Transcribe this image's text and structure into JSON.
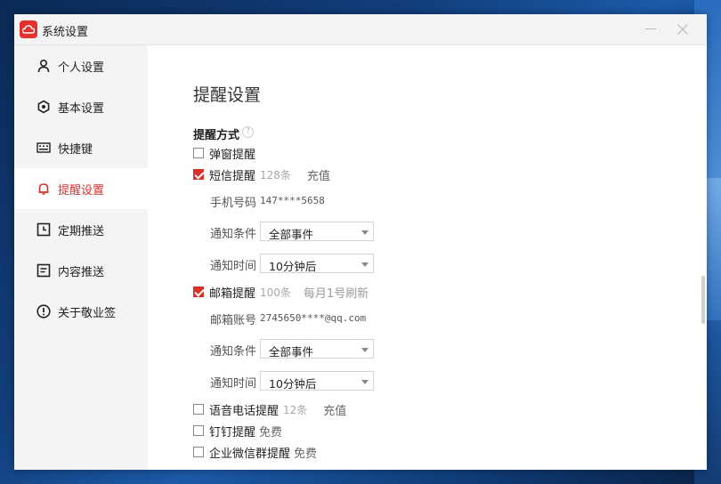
{
  "window": {
    "title": "系统设置"
  },
  "sidebar": {
    "items": [
      {
        "label": "个人设置",
        "icon": "user-icon",
        "active": false
      },
      {
        "label": "基本设置",
        "icon": "settings-icon",
        "active": false
      },
      {
        "label": "快捷键",
        "icon": "keyboard-icon",
        "active": false
      },
      {
        "label": "提醒设置",
        "icon": "bell-icon",
        "active": true
      },
      {
        "label": "定期推送",
        "icon": "schedule-icon",
        "active": false
      },
      {
        "label": "内容推送",
        "icon": "document-icon",
        "active": false
      },
      {
        "label": "关于敬业签",
        "icon": "info-icon",
        "active": false
      }
    ]
  },
  "main": {
    "title": "提醒设置",
    "section_title": "提醒方式",
    "popup": {
      "label": "弹窗提醒",
      "checked": false
    },
    "sms": {
      "label": "短信提醒",
      "checked": true,
      "count": "128条",
      "action": "充值",
      "phone_label": "手机号码",
      "phone_value": "147****5658",
      "condition_label": "通知条件",
      "condition_value": "全部事件",
      "time_label": "通知时间",
      "time_value": "10分钟后"
    },
    "email": {
      "label": "邮箱提醒",
      "checked": true,
      "count": "100条",
      "note": "每月1号刷新",
      "account_label": "邮箱账号",
      "account_value": "2745650****@qq.com",
      "condition_label": "通知条件",
      "condition_value": "全部事件",
      "time_label": "通知时间",
      "time_value": "10分钟后"
    },
    "voice": {
      "label": "语音电话提醒",
      "checked": false,
      "count": "12条",
      "action": "充值"
    },
    "dingtalk": {
      "label": "钉钉提醒",
      "checked": false,
      "note": "免费"
    },
    "wecom": {
      "label": "企业微信群提醒",
      "checked": false,
      "note": "免费"
    }
  },
  "colors": {
    "accent": "#d9302a",
    "sidebar_bg": "#f4f4f4"
  }
}
